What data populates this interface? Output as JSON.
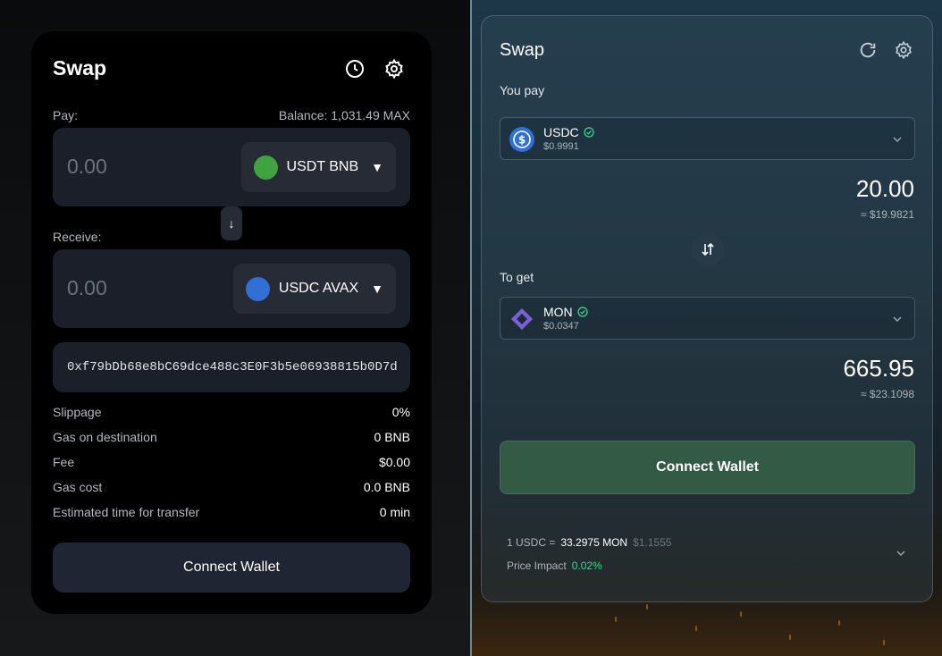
{
  "left": {
    "title": "Swap",
    "icons": {
      "history": "clock-icon",
      "settings": "gear-icon"
    },
    "pay_label": "Pay:",
    "balance": "Balance: 1,031.49 MAX",
    "pay_amount": "0.00",
    "pay_token": "USDT BNB",
    "pay_token_color": "#3fa33f",
    "swap_arrow": "↓",
    "receive_label": "Receive:",
    "receive_amount": "0.00",
    "receive_token": "USDC AVAX",
    "receive_token_color": "#2f6fd6",
    "caret": "▼",
    "address": "0xf79bDb68e8bC69dce488c3E0F3b5e06938815b0D7d",
    "details": [
      {
        "key": "Slippage",
        "value": "0%"
      },
      {
        "key": "Gas on destination",
        "value": "0 BNB"
      },
      {
        "key": "Fee",
        "value": "$0.00"
      },
      {
        "key": "Gas cost",
        "value": "0.0 BNB"
      },
      {
        "key": "Estimated time for transfer",
        "value": "0 min"
      }
    ],
    "connect_label": "Connect Wallet"
  },
  "right": {
    "title": "Swap",
    "icons": {
      "refresh": "refresh-icon",
      "settings": "gear-icon"
    },
    "you_pay_label": "You pay",
    "pay_token": {
      "symbol": "USDC",
      "price": "$0.9991",
      "icon": "usdc-icon"
    },
    "pay_amount": "20.00",
    "pay_usd": "≈ $19.9821",
    "to_get_label": "To get",
    "get_token": {
      "symbol": "MON",
      "price": "$0.0347",
      "icon": "mon-icon"
    },
    "get_amount": "665.95",
    "get_usd": "≈ $23.1098",
    "connect_label": "Connect Wallet",
    "rate": {
      "left": "1 USDC =",
      "value": "33.2975 MON",
      "usd": "$1.1555"
    },
    "impact": {
      "label": "Price Impact",
      "value": "0.02%"
    },
    "colors": {
      "accent_green": "#3dd68c",
      "button": "#325a45"
    }
  }
}
